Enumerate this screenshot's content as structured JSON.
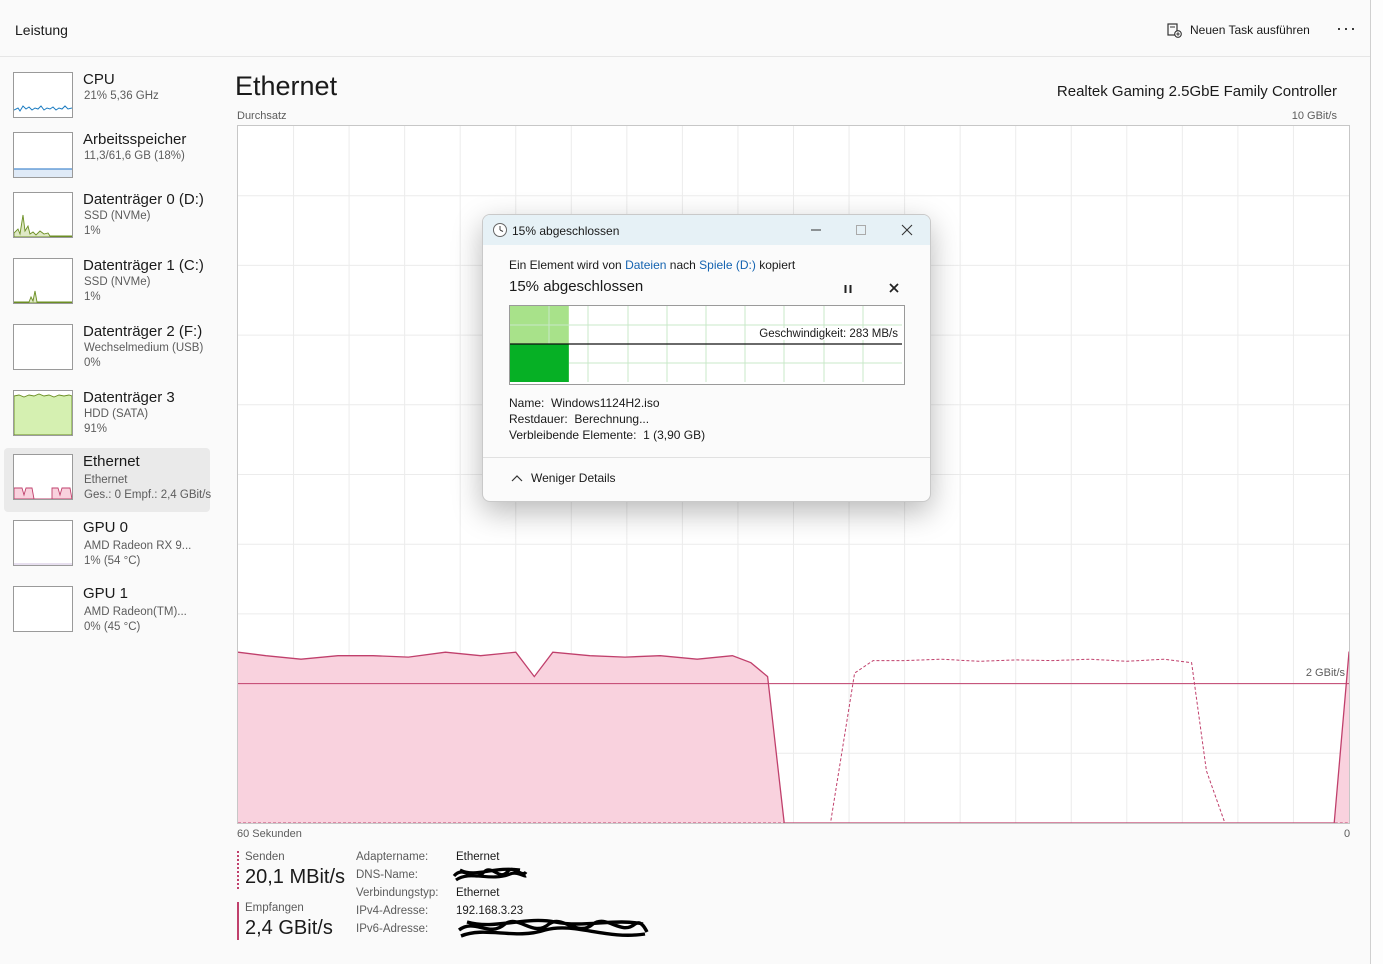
{
  "header": {
    "title": "Leistung",
    "run_task_label": "Neuen Task ausführen",
    "more_label": "···"
  },
  "sidebar": [
    {
      "name": "CPU",
      "line1": "21%  5,36 GHz",
      "line2": ""
    },
    {
      "name": "Arbeitsspeicher",
      "line1": "11,3/61,6 GB (18%)",
      "line2": ""
    },
    {
      "name": "Datenträger 0 (D:)",
      "line1": "SSD (NVMe)",
      "line2": "1%"
    },
    {
      "name": "Datenträger 1 (C:)",
      "line1": "SSD (NVMe)",
      "line2": "1%"
    },
    {
      "name": "Datenträger 2 (F:)",
      "line1": "Wechselmedium (USB)",
      "line2": "0%"
    },
    {
      "name": "Datenträger 3",
      "line1": "HDD (SATA)",
      "line2": "91%"
    },
    {
      "name": "Ethernet",
      "line1": "Ethernet",
      "line2": "Ges.: 0 Empf.: 2,4 GBit/s"
    },
    {
      "name": "GPU 0",
      "line1": "AMD Radeon RX 9...",
      "line2": "1% (54 °C)"
    },
    {
      "name": "GPU 1",
      "line1": "AMD Radeon(TM)...",
      "line2": "0% (45 °C)"
    }
  ],
  "main": {
    "title": "Ethernet",
    "adapter": "Realtek Gaming 2.5GbE Family Controller",
    "graph_label": "Durchsatz",
    "max_label": "10 GBit/s",
    "ref_label": "2 GBit/s",
    "time_label": "60 Sekunden",
    "zero_label": "0"
  },
  "chart_data": {
    "type": "area",
    "ylim": [
      0,
      10
    ],
    "xlim": [
      60,
      0
    ],
    "reference_line": 2,
    "series": [
      {
        "name": "Empfangen",
        "style": "solid-fill",
        "color": "#c0406c",
        "x": [
          60,
          58.5,
          56.6,
          54.6,
          52.7,
          50.8,
          48.8,
          46.9,
          45.0,
          44.0,
          43.0,
          41.0,
          39.1,
          37.2,
          35.2,
          33.3,
          32.3,
          31.4,
          30.5,
          0.8,
          0,
          -0.5
        ],
        "y": [
          2.45,
          2.4,
          2.35,
          2.4,
          2.4,
          2.38,
          2.45,
          2.4,
          2.45,
          2.1,
          2.45,
          2.4,
          2.38,
          2.4,
          2.35,
          2.4,
          2.3,
          2.1,
          0,
          0,
          2.45,
          2.45
        ]
      },
      {
        "name": "Senden",
        "style": "dashed",
        "color": "#c0406c",
        "x": [
          60,
          28.0,
          26.7,
          25.7,
          24.0,
          22.0,
          20.0,
          18.0,
          16.0,
          14.0,
          12.0,
          10.0,
          8.5,
          7.7,
          6.7,
          0
        ],
        "y": [
          0,
          0,
          2.15,
          2.33,
          2.33,
          2.35,
          2.32,
          2.34,
          2.33,
          2.35,
          2.32,
          2.35,
          2.3,
          0.75,
          0,
          0
        ]
      }
    ]
  },
  "stats": {
    "send_label": "Senden",
    "send_value": "20,1 MBit/s",
    "recv_label": "Empfangen",
    "recv_value": "2,4 GBit/s"
  },
  "props": [
    {
      "key": "Adaptername:",
      "value": "Ethernet"
    },
    {
      "key": "DNS-Name:",
      "value": ""
    },
    {
      "key": "Verbindungstyp:",
      "value": "Ethernet"
    },
    {
      "key": "IPv4-Adresse:",
      "value": "192.168.3.23"
    },
    {
      "key": "IPv6-Adresse:",
      "value": ""
    }
  ],
  "dialog": {
    "title": "15% abgeschlossen",
    "copy_prefix": "Ein Element wird von",
    "from": "Dateien",
    "mid": "nach",
    "to": "Spiele (D:)",
    "suffix": "kopiert",
    "percent_label": "15% abgeschlossen",
    "progress": 0.15,
    "speed_label": "Geschwindigkeit: 283 MB/s",
    "name_label": "Name:",
    "name_value": "Windows1124H2.iso",
    "remaining_label": "Restdauer:",
    "remaining_value": "Berechnung...",
    "items_label": "Verbleibende Elemente:",
    "items_value": "1 (3,90 GB)",
    "less_details": "Weniger Details"
  },
  "colors": {
    "accent": "#c0406c",
    "fill": "#f9d2de",
    "progress_green": "#06b025",
    "progress_light": "#a8e28a",
    "link": "#1463b0"
  }
}
